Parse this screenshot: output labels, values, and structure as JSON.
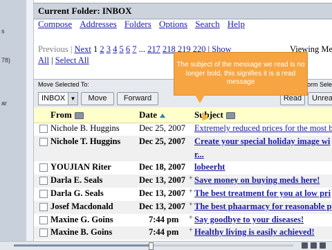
{
  "left_fragments": [
    "s",
    "78)",
    "ar"
  ],
  "folder": {
    "label": "Current Folder: INBOX"
  },
  "nav": [
    "Compose",
    "Addresses",
    "Folders",
    "Options",
    "Search",
    "Help"
  ],
  "pager": {
    "previous": "Previous",
    "next": "Next",
    "current": "1",
    "pages": [
      "2",
      "3",
      "4",
      "5",
      "6",
      "7"
    ],
    "ellipsis": "...",
    "late_pages": [
      "217",
      "218",
      "219",
      "220"
    ],
    "show": "Show",
    "viewing": "Viewing Me"
  },
  "select": {
    "all": "All",
    "separator": "|",
    "selected": "Select All"
  },
  "move_bar": {
    "label": "Move Selected To:",
    "form_label": "form Sele",
    "folder_value": "INBOX",
    "move_btn": "Move",
    "forward_btn": "Forward",
    "read_btn": "Read",
    "unread_btn": "Unrea"
  },
  "columns": {
    "from": "From",
    "date": "Date",
    "subject": "Subject"
  },
  "messages": [
    {
      "from": "Nichole B. Huggins",
      "date": "Dec 25, 2007",
      "plus": "",
      "subject": "Extremely reduced prices for the most b",
      "unread": false
    },
    {
      "from": "Nichole T. Huggins",
      "date": "Dec 25, 2007",
      "plus": "",
      "subject": "Create your special holiday image wi",
      "unread": true
    },
    {
      "from": "",
      "date": "",
      "plus": "",
      "subject": "r...",
      "unread": true
    },
    {
      "from": "YOUJIAN Riter",
      "date": "Dec 18, 2007",
      "plus": "",
      "subject": "lobeerht",
      "unread": true
    },
    {
      "from": "Darla E. Seals",
      "date": "Dec 13, 2007",
      "plus": "+",
      "subject": "Save money on buying meds here!",
      "unread": true
    },
    {
      "from": "Darla G. Seals",
      "date": "Dec 13, 2007",
      "plus": "+",
      "subject": "The best treatment for you at low pri",
      "unread": true
    },
    {
      "from": "Josef Macdonald",
      "date": "Dec 13, 2007",
      "plus": "+",
      "subject": "The best phaarmacy for reasonable p",
      "unread": true
    },
    {
      "from": "Maxine G. Goins",
      "date": "7:44 pm",
      "plus": "+",
      "subject": "Say goodbye to your diseases!",
      "unread": true
    },
    {
      "from": "Maxine B. Goins",
      "date": "7:44 pm",
      "plus": "+",
      "subject": "Healthy living is easily achieved!",
      "unread": true
    }
  ],
  "tooltip": {
    "text": "The subject of the message we read is no longer bold, this signifies it is a read message"
  },
  "player": {
    "progress": 0.49
  },
  "colors": {
    "link": "#1a1aa6",
    "tooltip": "#f6a542",
    "header_bg": "#ffffcc",
    "folder_bar": "#cdd3dc"
  }
}
